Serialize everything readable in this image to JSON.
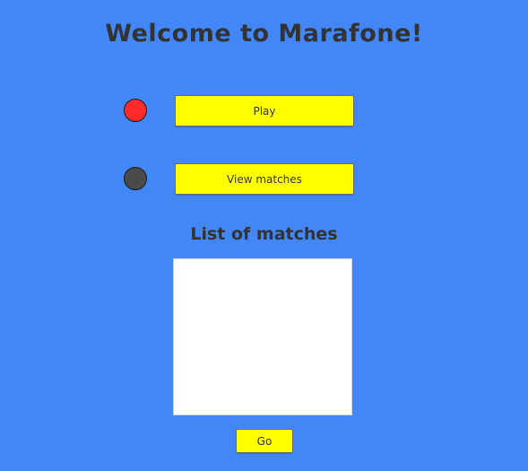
{
  "title": "Welcome to Marafone!",
  "status_indicators": {
    "play_color": "#ff2a2a",
    "matches_color": "#4a4a4a"
  },
  "buttons": {
    "play_label": "Play",
    "view_matches_label": "View matches",
    "go_label": "Go"
  },
  "matches": {
    "heading": "List of matches",
    "items": []
  },
  "colors": {
    "background": "#4287f5",
    "button": "#ffff00",
    "text": "#333333"
  }
}
